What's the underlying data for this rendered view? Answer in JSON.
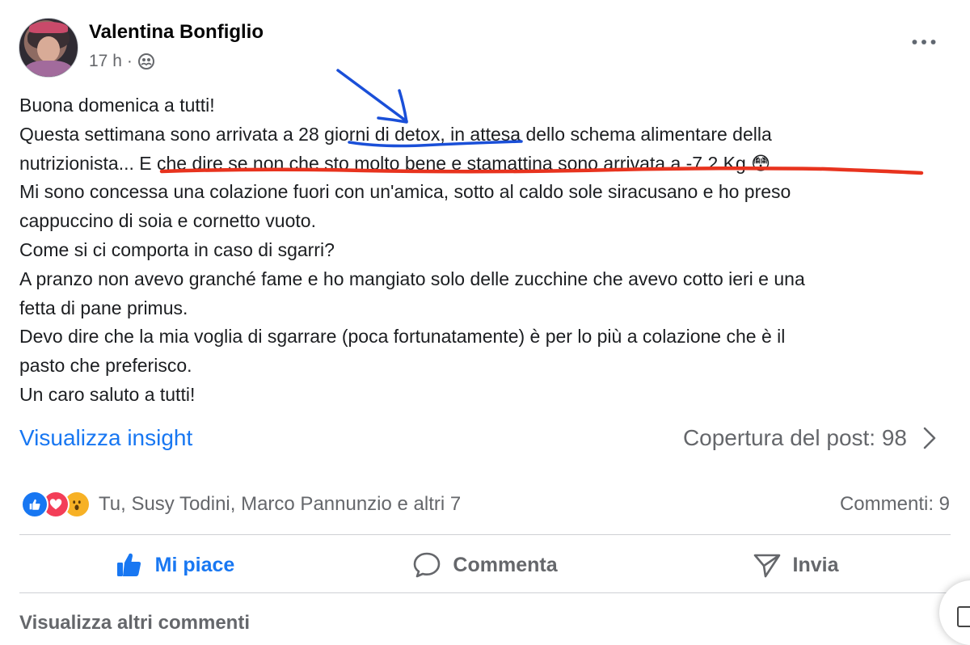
{
  "post": {
    "author": "Valentina Bonfiglio",
    "time": "17 h",
    "separator": "·",
    "lines": [
      "Buona domenica a tutti!",
      "Questa settimana sono arrivata a 28 giorni di detox, in attesa dello schema alimentare della",
      "nutrizionista... E che dire se non che sto molto bene e stamattina sono arrivata a -7.2 Kg 😳",
      "Mi sono concessa una colazione fuori con un'amica, sotto al caldo sole siracusano e ho preso",
      "cappuccino di soia e cornetto vuoto.",
      "Come si ci comporta in caso di sgarri?",
      "A pranzo non avevo granché fame e ho mangiato solo delle zucchine che avevo cotto ieri e una",
      "fetta di pane primus.",
      "Devo dire che la mia voglia di sgarrare (poca fortunatamente) è per lo più a colazione che è il",
      "pasto che preferisco.",
      "Un caro saluto a tutti!"
    ]
  },
  "insight": {
    "link": "Visualizza insight",
    "reach_label": "Copertura del post: 98"
  },
  "reactions": {
    "names": "Tu, Susy Todini, Marco Pannunzio e altri 7",
    "comments": "Commenti: 9",
    "icons": [
      "like-icon",
      "love-icon",
      "wow-icon"
    ]
  },
  "actions": {
    "like": "Mi piace",
    "comment": "Commenta",
    "share": "Invia"
  },
  "footer": {
    "more_comments": "Visualizza altri commenti"
  },
  "colors": {
    "link_blue": "#1877f2",
    "annotation_blue": "#1a4fd8",
    "annotation_red": "#e8331e",
    "muted": "#65676b"
  }
}
